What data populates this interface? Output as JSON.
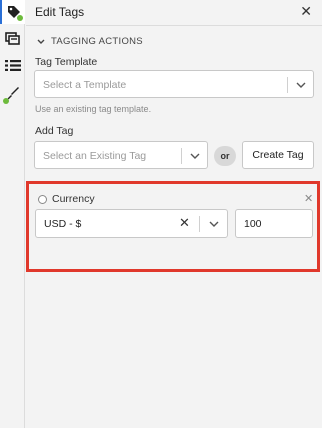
{
  "sidebar": {
    "items": [
      {
        "icon": "tag-icon",
        "active": true,
        "status_dot": true
      },
      {
        "icon": "layers-icon",
        "active": false,
        "status_dot": false
      },
      {
        "icon": "list-icon",
        "active": false,
        "status_dot": false
      },
      {
        "icon": "brush-icon",
        "active": false,
        "status_dot": true
      }
    ],
    "accent_color": "#2a6fd6",
    "dot_color": "#6dbb3c"
  },
  "panel": {
    "title": "Edit Tags",
    "section_title": "TAGGING ACTIONS",
    "tag_template": {
      "label": "Tag Template",
      "placeholder": "Select a Template",
      "help": "Use an existing tag template."
    },
    "add_tag": {
      "label": "Add Tag",
      "placeholder": "Select an Existing Tag",
      "or_text": "or",
      "create_button": "Create Tag"
    },
    "currency_tag": {
      "name": "Currency",
      "selected_value": "USD - $",
      "amount": "100",
      "highlight_color": "#e0382b"
    }
  }
}
